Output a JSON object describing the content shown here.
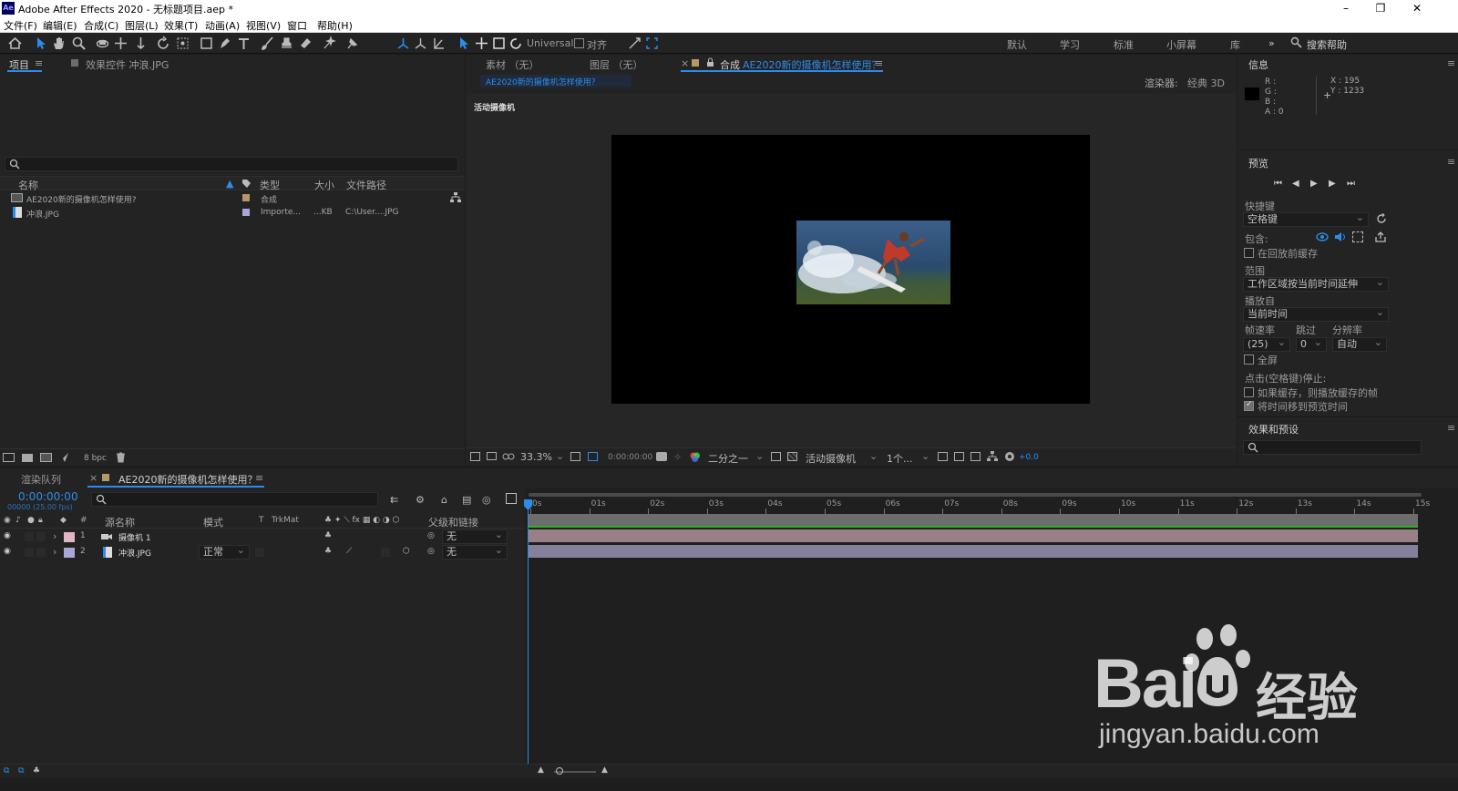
{
  "window": {
    "app_icon_text": "Ae",
    "title": "Adobe After Effects 2020 - 无标题项目.aep *",
    "controls": [
      "–",
      "❐",
      "✕"
    ]
  },
  "menu": [
    "文件(F)",
    "编辑(E)",
    "合成(C)",
    "图层(L)",
    "效果(T)",
    "动画(A)",
    "视图(V)",
    "窗口",
    "帮助(H)"
  ],
  "toolbar": {
    "axis_mode": "Universal",
    "snap_label": "对齐",
    "workspaces": [
      "默认",
      "学习",
      "标准",
      "小屏幕",
      "库"
    ],
    "more": "»",
    "search_placeholder": "搜索帮助"
  },
  "project_panel": {
    "tab_project": "项目",
    "tab_effects": "效果控件 冲浪.JPG",
    "columns": [
      "名称",
      "类型",
      "大小",
      "文件路径"
    ],
    "items": [
      {
        "name": "AE2020新的摄像机怎样使用?",
        "type": "合成",
        "size": "",
        "path": "",
        "color": "#b4976a"
      },
      {
        "name": "冲浪.JPG",
        "type": "Importe...",
        "size": "...KB",
        "path": "C:\\User....JPG",
        "color": "#a9a7d9"
      }
    ],
    "bpc": "8 bpc"
  },
  "viewer": {
    "tab_footage": "素材 （无）",
    "tab_layer": "图层 （无）",
    "tab_comp_prefix": "合成",
    "tab_comp_name": "AE2020新的摄像机怎样使用？",
    "breadcrumb": "AE2020新的摄像机怎样使用？",
    "renderer_label": "渲染器:",
    "renderer_value": "经典 3D",
    "view_label": "活动摄像机",
    "zoom": "33.3%",
    "timecode": "0:00:00:00",
    "resolution": "二分之一",
    "camera": "活动摄像机",
    "views": "1个...",
    "exposure": "+0.0"
  },
  "info_panel": {
    "title": "信息",
    "rgba": [
      "R :",
      "G :",
      "B :",
      "A : 0"
    ],
    "x": "X : 195",
    "y": "Y : 1233"
  },
  "preview_panel": {
    "title": "预览",
    "shortcut_label": "快捷键",
    "shortcut_value": "空格键",
    "include_label": "包含:",
    "cache_before": "在回放前缓存",
    "range_label": "范围",
    "range_value": "工作区域按当前时间延伸",
    "play_from_label": "播放自",
    "play_from_value": "当前时间",
    "fps_label": "帧速率",
    "skip_label": "跳过",
    "res_label": "分辨率",
    "fps_value": "(25)",
    "skip_value": "0",
    "res_value": "自动",
    "fullscreen": "全屏",
    "stop_label": "点击(空格键)停止:",
    "opt_cache": "如果缓存，则播放缓存的帧",
    "opt_move_time": "将时间移到预览时间",
    "opt_cache_checked": false,
    "opt_move_time_checked": true
  },
  "effects_panel": {
    "title": "效果和预设"
  },
  "timeline": {
    "tab_render": "渲染队列",
    "tab_comp": "AE2020新的摄像机怎样使用？",
    "timecode": "0:00:00:00",
    "fps_info": "00000 (25.00 fps)",
    "columns": {
      "num": "#",
      "name": "源名称",
      "mode": "模式",
      "t": "T",
      "trkmat": "TrkMat",
      "parent": "父级和链接"
    },
    "ruler": [
      "0s",
      "01s",
      "02s",
      "03s",
      "04s",
      "05s",
      "06s",
      "07s",
      "08s",
      "09s",
      "10s",
      "11s",
      "12s",
      "13s",
      "14s",
      "15s"
    ],
    "layers": [
      {
        "num": "1",
        "name": "摄像机 1",
        "mode": "",
        "parent": "无",
        "label_color": "#e3b4c1",
        "bar_color": "#9b7f88"
      },
      {
        "num": "2",
        "name": "冲浪.JPG",
        "mode": "正常",
        "parent": "无",
        "label_color": "#a9a7d9",
        "bar_color": "#85809b"
      }
    ]
  },
  "watermark": {
    "brand": "Bai",
    "brand_cn": "经验",
    "url": "jingyan.baidu.com"
  },
  "colors": {
    "accent": "#2d8ceb",
    "panel_bg": "#232323",
    "dark_bg": "#1d1d1d"
  }
}
